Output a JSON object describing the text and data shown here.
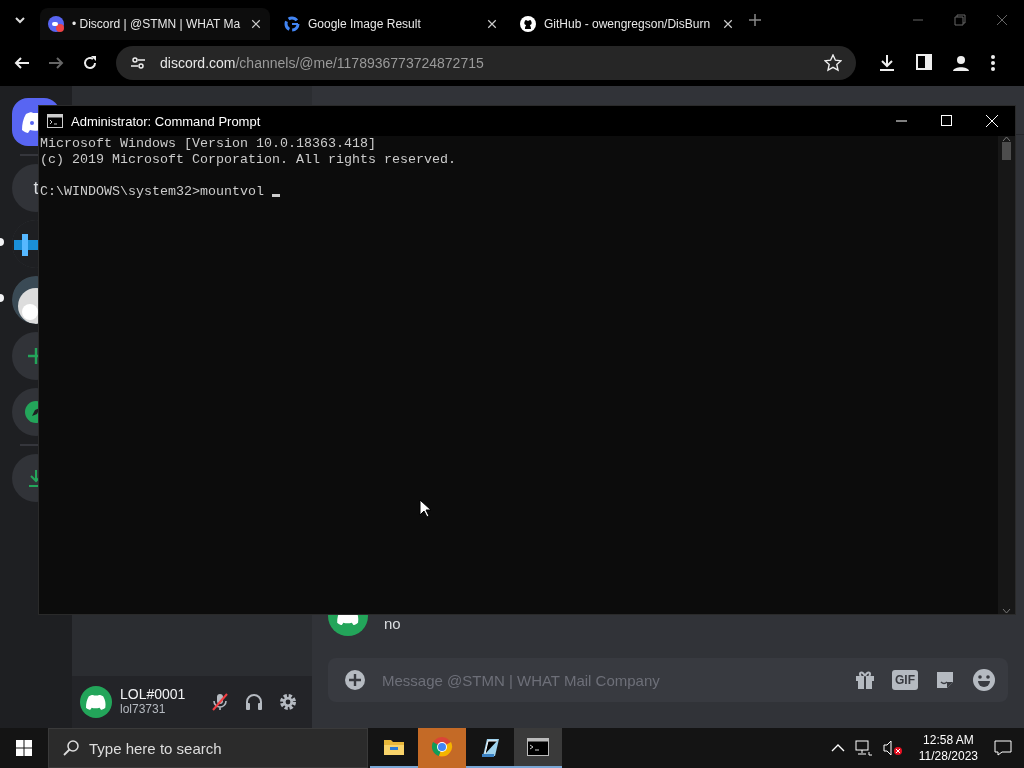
{
  "browser": {
    "tabs": [
      {
        "title": "• Discord | @STMN | WHAT Ma",
        "kind": "discord",
        "selected": true
      },
      {
        "title": "Google Image Result",
        "kind": "google",
        "selected": false
      },
      {
        "title": "GitHub - owengregson/DisBurn",
        "kind": "github",
        "selected": false
      }
    ],
    "url": {
      "host": "discord.com",
      "path": "/channels/@me/1178936773724872715"
    }
  },
  "discord": {
    "servers": [
      {
        "kind": "home",
        "unread": false
      },
      {
        "kind": "letter",
        "label": "t",
        "unread": false
      },
      {
        "kind": "picture",
        "unread": true
      },
      {
        "kind": "picture",
        "unread": true
      },
      {
        "kind": "add",
        "unread": false
      },
      {
        "kind": "explore",
        "unread": false
      },
      {
        "kind": "download",
        "unread": false
      }
    ],
    "messages": [
      {
        "text": "no"
      }
    ],
    "composer": {
      "placeholder": "Message @STMN | WHAT Mail Company",
      "gif_label": "GIF"
    },
    "user": {
      "name": "LOL#0001",
      "tag": "lol73731",
      "muted": true
    }
  },
  "cmd": {
    "title": "Administrator: Command Prompt",
    "lines": [
      "Microsoft Windows [Version 10.0.18363.418]",
      "(c) 2019 Microsoft Corporation. All rights reserved."
    ],
    "prompt": "C:\\WINDOWS\\system32>mountvol "
  },
  "taskbar": {
    "search_placeholder": "Type here to search",
    "apps": [
      {
        "kind": "explorer",
        "selected": false,
        "flashing": false
      },
      {
        "kind": "chrome",
        "selected": false,
        "flashing": true
      },
      {
        "kind": "notepad",
        "selected": false,
        "flashing": false
      },
      {
        "kind": "cmd",
        "selected": true,
        "flashing": false
      }
    ],
    "time": "12:58 AM",
    "date": "11/28/2023"
  }
}
